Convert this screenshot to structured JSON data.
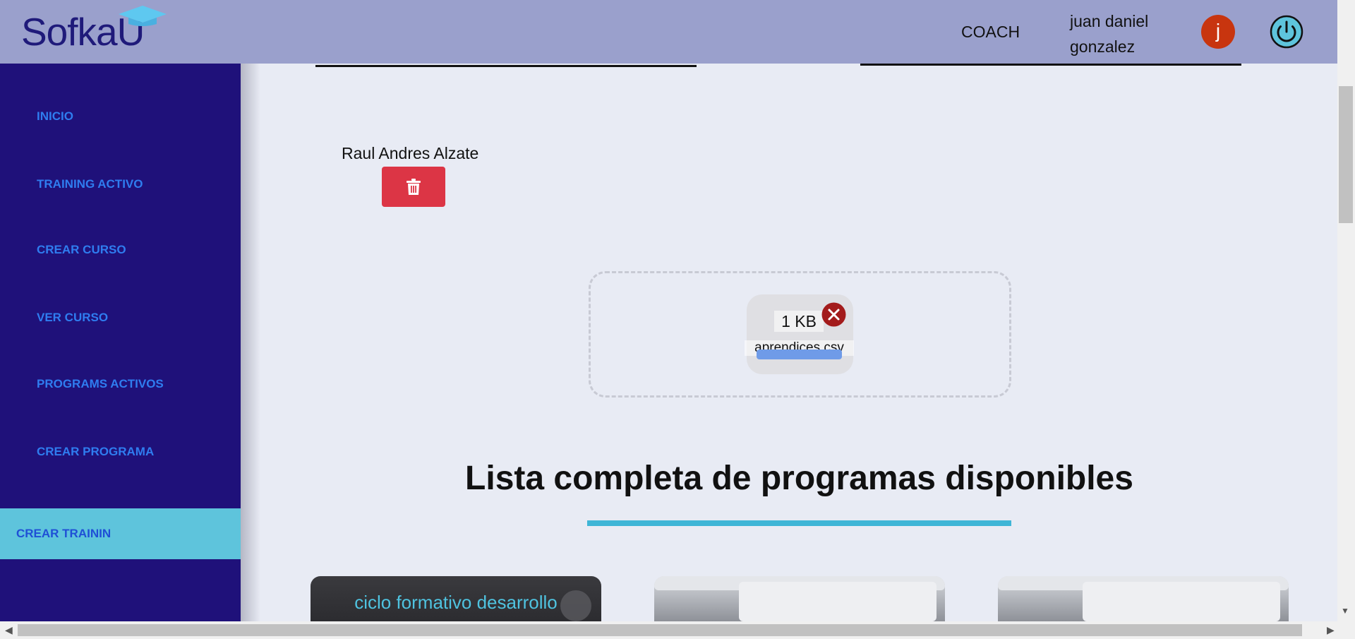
{
  "header": {
    "logo_text": "SofkaU",
    "role": "COACH",
    "user_name": "juan daniel gonzalez",
    "avatar_letter": "j",
    "power_icon": "power-icon"
  },
  "sidebar": {
    "items": [
      {
        "label": "INICIO"
      },
      {
        "label": "TRAINING ACTIVO"
      },
      {
        "label": "CREAR CURSO"
      },
      {
        "label": "VER CURSO"
      },
      {
        "label": "PROGRAMS ACTIVOS"
      },
      {
        "label": "CREAR PROGRAMA"
      }
    ],
    "active_item": {
      "label": "CREAR TRAININ"
    }
  },
  "main": {
    "apprentice_name": "Raul Andres Alzate",
    "delete_icon": "trash-icon",
    "upload": {
      "file_size": "1 KB",
      "file_name": "aprendices.csv",
      "progress": 1.0
    },
    "section_title": "Lista completa de programas disponibles",
    "cards": [
      {
        "title": "ciclo formativo desarrollo"
      },
      {
        "title": ""
      },
      {
        "title": ""
      }
    ]
  },
  "colors": {
    "header_bg": "#9aa0cc",
    "sidebar_bg": "#1f117a",
    "sidebar_link": "#2f7df0",
    "sidebar_active_bg": "#5ec4dc",
    "delete_red": "#dc3545",
    "accent_cyan": "#3fb5d6"
  }
}
